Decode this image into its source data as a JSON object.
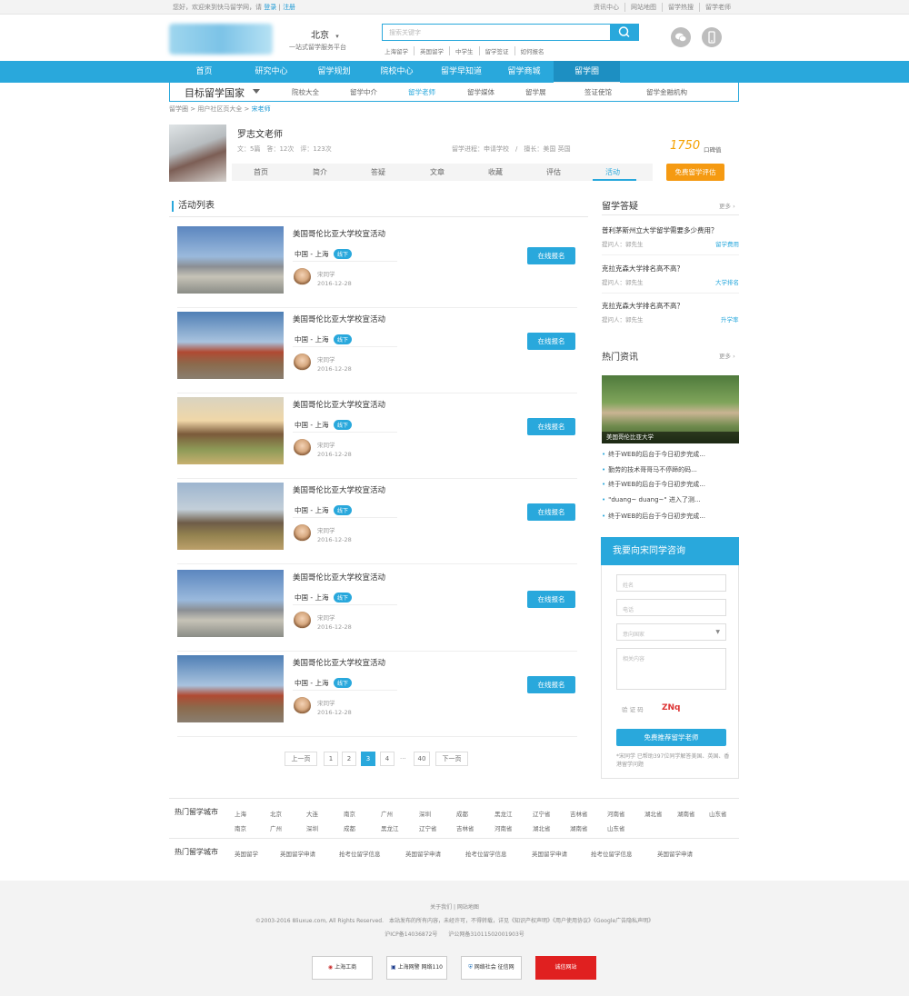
{
  "topbar": {
    "welcome": "您好，欢迎来到快马留学网，请",
    "login": "登录",
    "register": "注册",
    "links": [
      "资讯中心",
      "网站地图",
      "留学热搜",
      "留学老师"
    ]
  },
  "header": {
    "city": "北京",
    "slogan": "一站式留学服务平台",
    "search_placeholder": "搜索关键字",
    "hot_keywords": [
      "上海留学",
      "英国留学",
      "中学生",
      "留学签证",
      "如何报名"
    ]
  },
  "nav": {
    "items": [
      "首页",
      "研究中心",
      "留学规划",
      "院校中心",
      "留学早知道",
      "留学商城",
      "留学圈"
    ]
  },
  "subnav": {
    "title": "目标留学国家",
    "items": [
      "院校大全",
      "留学中介",
      "留学老师",
      "留学媒体",
      "留学展",
      "签证使馆",
      "留学金融机构"
    ]
  },
  "breadcrumb": [
    "留学圈",
    "用户社区页大全",
    "宋老师"
  ],
  "teacher": {
    "name": "罗志文老师",
    "stats": "文：5篇　答：12次　评：123次",
    "meta": "留学进程：申请学校　/　擅长：美国 英国",
    "score": "1750",
    "score_label": "口碑值",
    "tabs": [
      "首页",
      "简介",
      "答疑",
      "文章",
      "收藏",
      "评估",
      "活动"
    ],
    "free_btn": "免费留学评估"
  },
  "activities": {
    "heading": "活动列表",
    "items": [
      {
        "title": "美国哥伦比亚大学校宣活动",
        "location": "中国 - 上海",
        "tag": "线下",
        "user": "宋同学",
        "date": "2016-12-28",
        "button": "在线报名"
      },
      {
        "title": "美国哥伦比亚大学校宣活动",
        "location": "中国 - 上海",
        "tag": "线下",
        "user": "宋同学",
        "date": "2016-12-28",
        "button": "在线报名"
      },
      {
        "title": "美国哥伦比亚大学校宣活动",
        "location": "中国 - 上海",
        "tag": "线下",
        "user": "宋同学",
        "date": "2016-12-28",
        "button": "在线报名"
      },
      {
        "title": "美国哥伦比亚大学校宣活动",
        "location": "中国 - 上海",
        "tag": "线下",
        "user": "宋同学",
        "date": "2016-12-28",
        "button": "在线报名"
      },
      {
        "title": "美国哥伦比亚大学校宣活动",
        "location": "中国 - 上海",
        "tag": "线下",
        "user": "宋同学",
        "date": "2016-12-28",
        "button": "在线报名"
      },
      {
        "title": "美国哥伦比亚大学校宣活动",
        "location": "中国 - 上海",
        "tag": "线下",
        "user": "宋同学",
        "date": "2016-12-28",
        "button": "在线报名"
      }
    ]
  },
  "pagination": {
    "prev": "上一页",
    "pages": [
      "1",
      "2",
      "3",
      "4"
    ],
    "ellipsis": "...",
    "last": "40",
    "next": "下一页",
    "current": "3"
  },
  "qa": {
    "heading": "留学答疑",
    "more": "更多",
    "items": [
      {
        "q": "普利茅斯州立大学留学需要多少费用？",
        "asker": "提问人：郭先生",
        "tag": "留学费用"
      },
      {
        "q": "克拉克森大学排名高不高？",
        "asker": "提问人：郭先生",
        "tag": "大学排名"
      },
      {
        "q": "克拉克森大学排名高不高？",
        "asker": "提问人：郭先生",
        "tag": "升学率"
      }
    ]
  },
  "news": {
    "heading": "热门资讯",
    "more": "更多",
    "caption": "美国哥伦比亚大学",
    "items": [
      "终于WEB的后台于今日初步完成...",
      "勤劳的技术哥哥马不停蹄的码...",
      "终于WEB的后台于今日初步完成...",
      "\"duang~ duang~\" 进入了测...",
      "终于WEB的后台于今日初步完成..."
    ]
  },
  "consult": {
    "heading": "我要向宋同学咨询",
    "name_ph": "姓名",
    "phone_ph": "电话",
    "country_ph": "意向国家",
    "content_ph": "相关内容",
    "captcha_label": "验 证 码",
    "captcha": "ZNq",
    "submit": "免费推荐留学老师",
    "note": "*宋同学 已帮助397位同学解答美国、英国、香港留学问题"
  },
  "hot_cities": {
    "label": "热门留学城市",
    "row1": [
      "上海",
      "北京",
      "大连",
      "南京",
      "广州",
      "深圳",
      "成都",
      "黑龙江",
      "辽宁省",
      "吉林省",
      "河南省",
      "湖北省",
      "湖南省",
      "山东省"
    ],
    "row2": [
      "南京",
      "广州",
      "深圳",
      "成都",
      "黑龙江",
      "辽宁省",
      "吉林省",
      "河南省",
      "湖北省",
      "湖南省",
      "山东省"
    ],
    "label2": "热门留学城市",
    "row3": [
      "英国留学",
      "英国留学申请",
      "抢考位留学信息",
      "英国留学申请",
      "抢考位留学信息",
      "英国留学申请",
      "抢考位留学信息",
      "英国留学申请"
    ]
  },
  "footer": {
    "links": "关于我们 | 网站地图",
    "copyright": "©2003-2016 8liuxue.com, All Rights Reserved.　本站发布的所有内容，未经许可，不得转载，详见《知识产权声明》《用户使用协议》《Google广告隐私声明》",
    "icp": "沪ICP备14036872号　　沪公网备31011502001903号",
    "badges": [
      "上海工商",
      "上海网警 网络110",
      "网络社会 征信网",
      "诚信网站"
    ]
  },
  "colors": {
    "primary": "#29a8dc",
    "accent": "#f59a12"
  }
}
